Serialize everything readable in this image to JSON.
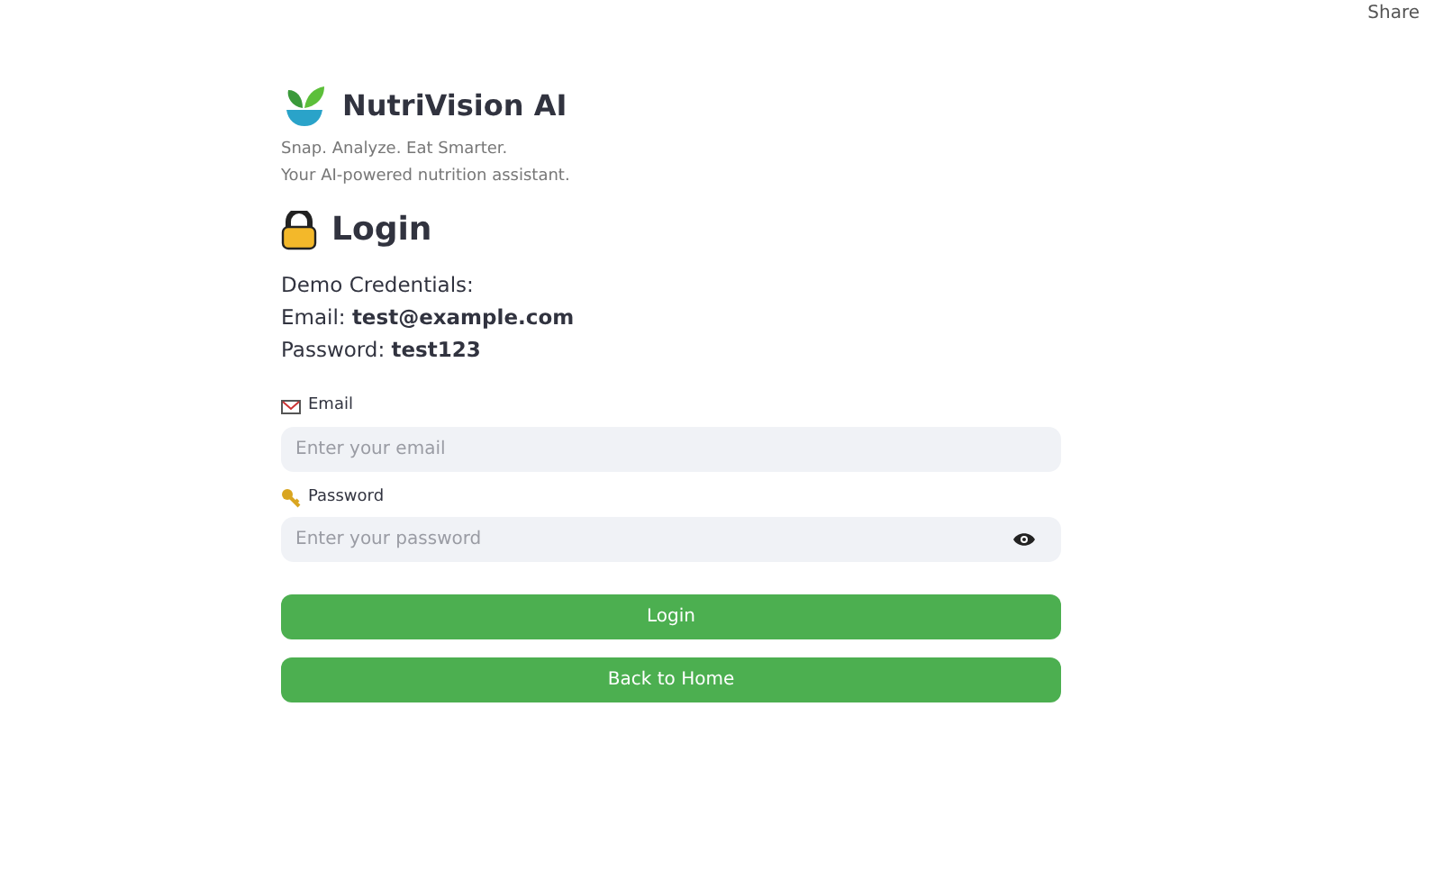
{
  "header": {
    "share": "Share"
  },
  "brand": {
    "name": "NutriVision AI",
    "tagline": "Snap. Analyze. Eat Smarter.",
    "subtitle": "Your AI-powered nutrition assistant."
  },
  "heading": "Login",
  "credentials": [
    "Demo Credentials:",
    "Email: **test@example.com**",
    "Password: **test123**"
  ],
  "fields": [
    {
      "label": "Email",
      "placeholder": "Enter your email",
      "kind": "email"
    },
    {
      "label": "Password",
      "placeholder": "Enter your password",
      "kind": "password"
    }
  ],
  "buttons": [
    "Login",
    "Back to Home"
  ]
}
